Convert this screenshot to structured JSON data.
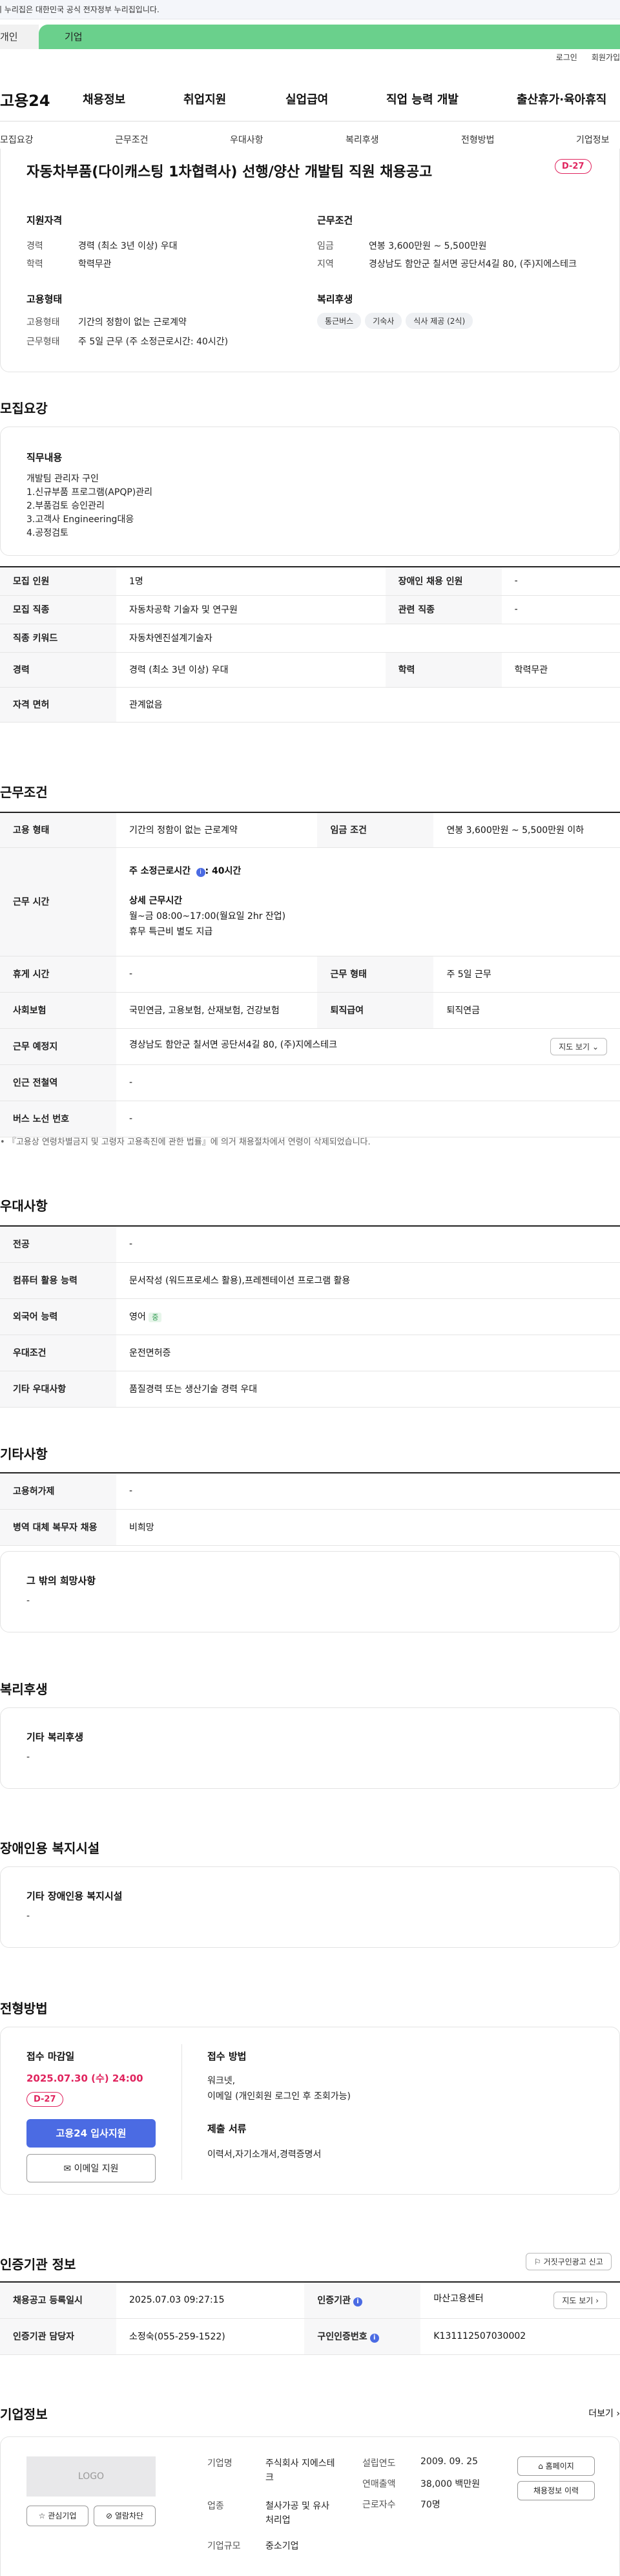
{
  "gov_notice": "이 누리집은 대한민국 공식 전자정부 누리집입니다.",
  "top_tabs": {
    "individual": "개인",
    "corporate": "기업"
  },
  "utility": {
    "login": "로그인",
    "join": "회원가입"
  },
  "logo": "고용24",
  "gnb": [
    "채용정보",
    "취업지원",
    "실업급여",
    "직업 능력 개발",
    "출산휴가·육아휴직"
  ],
  "subnav": [
    "모집요강",
    "근무조건",
    "우대사항",
    "복리후생",
    "전형방법",
    "기업정보"
  ],
  "summary": {
    "title": "자동차부품(다이캐스팅 1차협력사) 선행/양산 개발팀 직원 채용공고",
    "dday": "D-27",
    "qual_heading": "지원자격",
    "career_label": "경력",
    "career_value": "경력 (최소 3년 이상) 우대",
    "edu_label": "학력",
    "edu_value": "학력무관",
    "cond_heading": "근무조건",
    "wage_label": "임금",
    "wage_value": "연봉 3,600만원 ~ 5,500만원",
    "region_label": "지역",
    "region_value": "경상남도 함안군 칠서면 공단서4길 80, (주)지에스테크",
    "emp_heading": "고용형태",
    "type_label": "고용형태",
    "type_value": "기간의 정함이 없는 근로계약",
    "form_label": "근무형태",
    "form_value": "주 5일 근무 (주 소정근로시간: 40시간)",
    "welfare_heading": "복리후생",
    "chips": [
      "통근버스",
      "기숙사",
      "식사 제공 (2식)"
    ]
  },
  "recruit": {
    "heading": "모집요강",
    "job_heading": "직무내용",
    "job_lines": [
      "개발팀 관리자 구인",
      "1.신규부품 프로그램(APQP)관리",
      "2.부품검토 승인관리",
      "3.고객사 Engineering대응",
      "4.공정검토"
    ],
    "rows": [
      [
        "모집 인원",
        "1명",
        "장애인 채용 인원",
        "-"
      ],
      [
        "모집 직종",
        "자동차공학 기술자 및 연구원",
        "관련 직종",
        "-"
      ],
      [
        "직종 키워드",
        "자동차엔진설계기술자"
      ],
      [
        "경력",
        "경력 (최소 3년 이상) 우대",
        "학력",
        "학력무관"
      ],
      [
        "자격 면허",
        "관계없음"
      ]
    ]
  },
  "conditions": {
    "heading": "근무조건",
    "emp_type_label": "고용 형태",
    "emp_type": "기간의 정함이 없는 근로계약",
    "wage_label": "임금 조건",
    "wage": "연봉 3,600만원 ~ 5,500만원 이하",
    "hours_label": "근무 시간",
    "hours_weekly_label": "주 소정근로시간",
    "hours_weekly": ": 40시간",
    "hours_detail_label": "상세 근무시간",
    "hours_detail": "월~금 08:00~17:00(월요일 2hr 잔업)",
    "hours_note": "휴무 특근비 별도 지급",
    "rest_label": "휴게 시간",
    "rest": "-",
    "form_label": "근무 형태",
    "form": "주 5일 근무",
    "insurance_label": "사회보험",
    "insurance": "국민연금, 고용보험, 산재보험, 건강보험",
    "retire_label": "퇴직급여",
    "retire": "퇴직연금",
    "place_label": "근무 예정지",
    "place": "경상남도 함안군 칠서면 공단서4길 80, (주)지에스테크",
    "map_button": "지도 보기",
    "subway_label": "인근 전철역",
    "subway": "-",
    "bus_label": "버스 노선 번호",
    "bus": "-",
    "footnote": "『고용상 연령차별금지 및 고령자 고용촉진에 관한 법률』에 의거 채용절차에서 연령이 삭제되었습니다."
  },
  "preferences": {
    "heading": "우대사항",
    "rows": [
      [
        "전공",
        "-"
      ],
      [
        "컴퓨터 활용 능력",
        "문서작성 (워드프로세스 활용),프레젠테이션 프로그램 활용"
      ],
      [
        "외국어 능력",
        "영어"
      ],
      [
        "우대조건",
        "운전면허증"
      ],
      [
        "기타 우대사항",
        "품질경력 또는 생산기술 경력 우대"
      ]
    ],
    "lang_badge": "중"
  },
  "etc": {
    "heading": "기타사항",
    "rows": [
      [
        "고용허가제",
        "-"
      ],
      [
        "병역 대체 복무자 채용",
        "비희망"
      ]
    ],
    "wish_heading": "그 밖의 희망사항",
    "wish": "-"
  },
  "welfare": {
    "heading": "복리후생",
    "sub": "기타 복리후생",
    "value": "-"
  },
  "disability": {
    "heading": "장애인용 복지시설",
    "sub": "기타 장애인용 복지시설",
    "value": "-"
  },
  "selection": {
    "heading": "전형방법",
    "deadline_label": "접수 마감일",
    "deadline": "2025.07.30 (수) 24:00",
    "dday": "D-27",
    "apply_button": "고용24 입사지원",
    "email_button": "이메일 지원",
    "method_label": "접수 방법",
    "method": "워크넷,",
    "method2": "이메일 (개인회원 로그인 후 조회가능)",
    "docs_label": "제출 서류",
    "docs": "이력서,자기소개서,경력증명서"
  },
  "agency": {
    "heading": "인증기관 정보",
    "report_button": "거짓구인광고 신고",
    "reg_date_label": "채용공고 등록일시",
    "reg_date": "2025.07.03 09:27:15",
    "inst_label": "인증기관",
    "inst": "마산고용센터",
    "inst_map": "지도 보기",
    "manager_label": "인증기관 담당자",
    "manager": "소정숙(055-259-1522)",
    "cert_label": "구인인증번호",
    "cert": "K131112507030002"
  },
  "company": {
    "heading": "기업정보",
    "more": "더보기",
    "logo_text": "LOGO",
    "interest_button": "관심기업",
    "block_button": "열람차단",
    "name_label": "기업명",
    "name": "주식회사 지에스테크",
    "industry_label": "업종",
    "industry": "철사가공 및 유사 처리업",
    "size_label": "기업규모",
    "size": "중소기업",
    "founded_label": "설립연도",
    "founded": "2009. 09. 25",
    "sales_label": "연매출액",
    "sales": "38,000 백만원",
    "employees_label": "근로자수",
    "employees": "70명",
    "homepage_button": "홈페이지",
    "listings_button": "채용정보 이력"
  }
}
